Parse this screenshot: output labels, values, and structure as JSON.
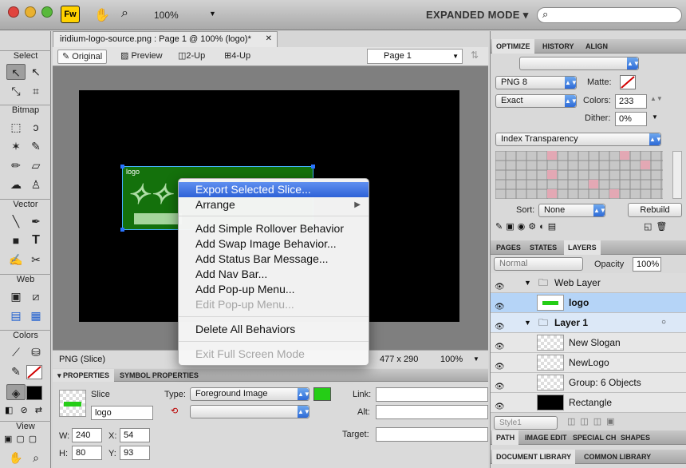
{
  "app": {
    "zoom": "100%",
    "mode_button": "EXPANDED MODE ▾",
    "app_icon": "Fw"
  },
  "document": {
    "tab_title": "iridium-logo-source.png : Page 1 @ 100% (logo)*",
    "close": "✕"
  },
  "view_buttons": {
    "original": "Original",
    "preview": "Preview",
    "two_up": "2-Up",
    "four_up": "4-Up",
    "page": "Page 1"
  },
  "tools": {
    "select": "Select",
    "bitmap": "Bitmap",
    "vector": "Vector",
    "web": "Web",
    "colors": "Colors",
    "view": "View"
  },
  "canvas": {
    "slice_label": "logo",
    "fill_color": "#25cd16"
  },
  "status": {
    "type": "PNG (Slice)",
    "size": "477 x 290",
    "zoom": "100%"
  },
  "context_menu": {
    "export": "Export Selected Slice...",
    "arrange": "Arrange",
    "add_simple_rollover": "Add Simple Rollover Behavior",
    "add_swap_image": "Add Swap Image Behavior...",
    "add_status_bar": "Add Status Bar Message...",
    "add_nav_bar": "Add Nav Bar...",
    "add_popup": "Add Pop-up Menu...",
    "edit_popup": "Edit Pop-up Menu...",
    "delete_behaviors": "Delete All Behaviors",
    "exit_fullscreen": "Exit Full Screen Mode"
  },
  "properties": {
    "tab_properties": "PROPERTIES",
    "tab_symbol": "SYMBOL PROPERTIES",
    "kind": "Slice",
    "name": "logo",
    "type_label": "Type:",
    "type_value": "Foreground Image",
    "link_label": "Link:",
    "alt_label": "Alt:",
    "target_label": "Target:",
    "w_label": "W:",
    "w": "240",
    "h_label": "H:",
    "h": "80",
    "x_label": "X:",
    "x": "54",
    "y_label": "Y:",
    "y": "93"
  },
  "optimize": {
    "tabs": [
      "OPTIMIZE",
      "HISTORY",
      "ALIGN"
    ],
    "format": "PNG 8",
    "matte_label": "Matte:",
    "palette": "Exact",
    "colors_label": "Colors:",
    "colors": "233",
    "dither_label": "Dither:",
    "dither": "0%",
    "transparency": "Index Transparency",
    "sort_label": "Sort:",
    "sort": "None",
    "rebuild": "Rebuild"
  },
  "layers": {
    "tabs": [
      "PAGES",
      "STATES",
      "LAYERS"
    ],
    "blend": "Normal",
    "opacity_label": "Opacity",
    "opacity": "100%",
    "rows": [
      "Web Layer",
      "logo",
      "Layer 1",
      "New Slogan",
      "NewLogo",
      "Group: 6 Objects",
      "Rectangle"
    ],
    "style": "Style1"
  },
  "bottom_tabs": {
    "row1": [
      "PATH",
      "IMAGE EDIT",
      "SPECIAL CH",
      "SHAPES"
    ],
    "row2": [
      "DOCUMENT LIBRARY",
      "COMMON LIBRARY"
    ]
  }
}
